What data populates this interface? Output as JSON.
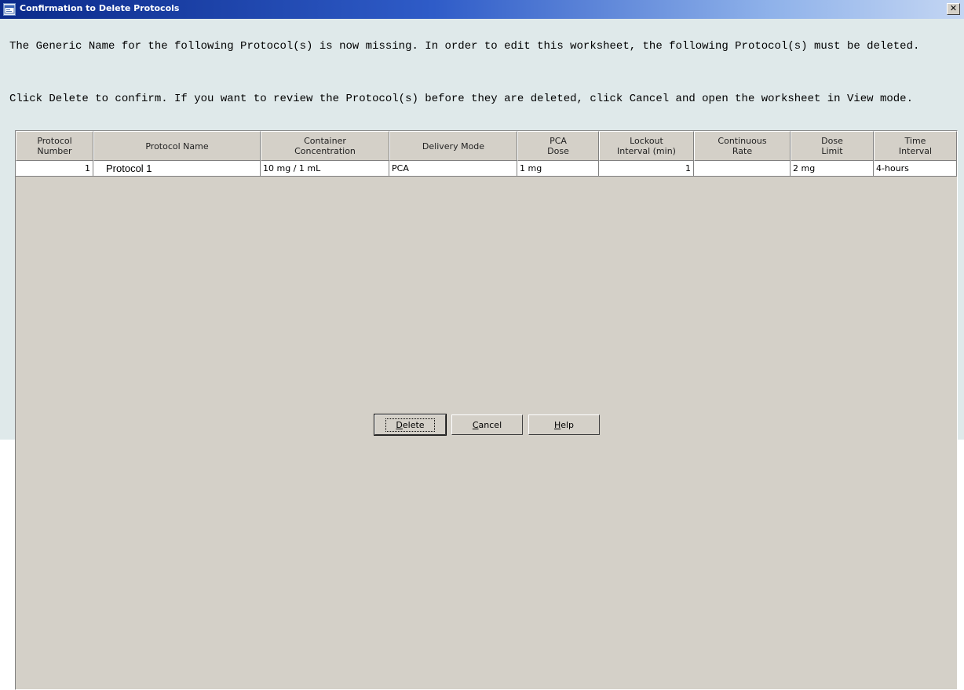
{
  "window": {
    "title": "Confirmation to Delete Protocols",
    "close_glyph": "✕"
  },
  "message": {
    "line1": "The Generic Name for the following Protocol(s) is now missing. In order to edit this worksheet, the following Protocol(s) must be deleted.",
    "line2": "Click Delete to confirm. If you want to review the Protocol(s) before they are deleted, click Cancel and open the worksheet in View mode."
  },
  "table": {
    "columns": [
      "Protocol\nNumber",
      "Protocol Name",
      "Container\nConcentration",
      "Delivery Mode",
      "PCA\nDose",
      "Lockout\nInterval (min)",
      "Continuous\nRate",
      "Dose\nLimit",
      "Time\nInterval"
    ],
    "rows": [
      [
        "1",
        "Protocol 1",
        "10 mg / 1 mL",
        "PCA",
        "1 mg",
        "1",
        "",
        "2 mg",
        "4-hours"
      ]
    ]
  },
  "buttons": {
    "delete": "Delete",
    "cancel": "Cancel",
    "help": "Help"
  },
  "colors": {
    "title_gradient_start": "#0b2a8a",
    "title_gradient_end": "#c4d6f3",
    "dialog_background": "#dfe9ea",
    "grid_background": "#d4d0c8"
  },
  "icons": {
    "title": "app-window-icon",
    "close": "close-icon"
  }
}
